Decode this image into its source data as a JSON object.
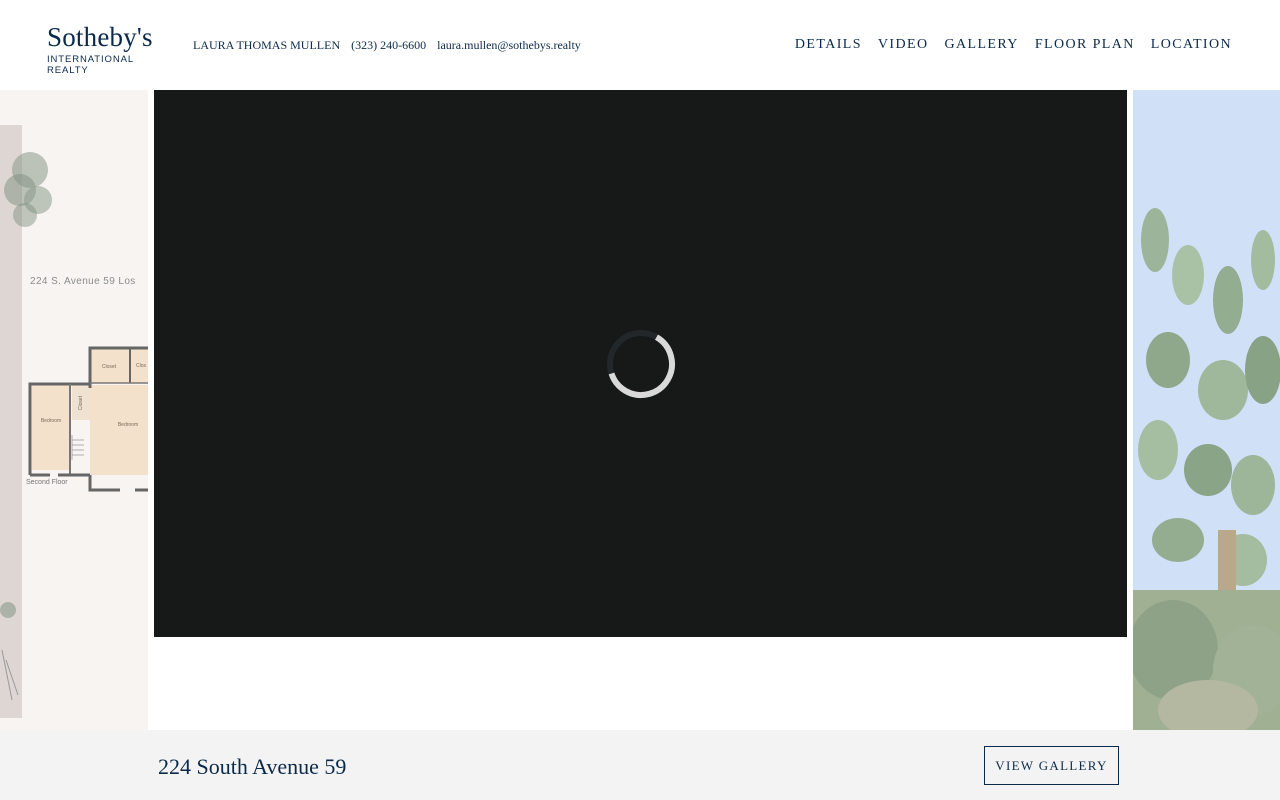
{
  "brand": {
    "name": "Sotheby's",
    "sub": "INTERNATIONAL REALTY"
  },
  "agent": {
    "name": "LAURA THOMAS MULLEN",
    "phone": "(323) 240-6600",
    "email": "laura.mullen@sothebys.realty"
  },
  "nav": {
    "items": [
      "DETAILS",
      "VIDEO",
      "GALLERY",
      "FLOOR PLAN",
      "LOCATION"
    ]
  },
  "slide_left": {
    "address": "224 S. Avenue 59   Los",
    "floor_label": "Second Floor",
    "rooms": [
      "Closet",
      "Clos",
      "Closet",
      "Bedroom",
      "Bedroom"
    ]
  },
  "video": {
    "state": "loading"
  },
  "footer": {
    "title": "224 South Avenue 59",
    "button": "VIEW GALLERY"
  },
  "colors": {
    "brand": "#0b2a4a",
    "video_bg": "#161917",
    "bar_bg": "#f3f3f3"
  }
}
